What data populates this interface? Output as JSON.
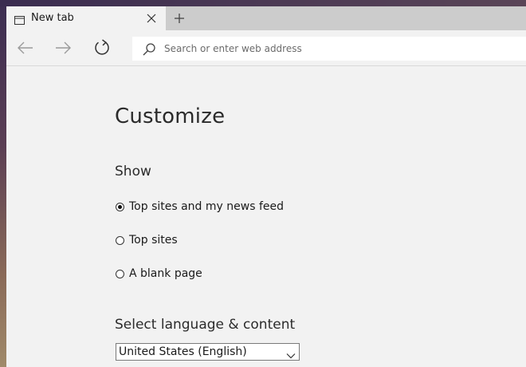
{
  "tab": {
    "title": "New tab",
    "icon": "tab-page-icon",
    "close_icon": "close-icon",
    "new_tab_icon": "plus-icon"
  },
  "navbar": {
    "back_icon": "arrow-left-icon",
    "forward_icon": "arrow-right-icon",
    "refresh_icon": "refresh-icon",
    "search_icon": "search-icon",
    "address_placeholder": "Search or enter web address",
    "address_value": ""
  },
  "page": {
    "title": "Customize",
    "show_heading": "Show",
    "options": [
      {
        "label": "Top sites and my news feed",
        "checked": true
      },
      {
        "label": "Top sites",
        "checked": false
      },
      {
        "label": "A blank page",
        "checked": false
      }
    ],
    "language_heading": "Select language & content",
    "language_selected": "United States (English)"
  },
  "colors": {
    "tabstrip_bg": "#cccccc",
    "window_bg": "#f2f2f2",
    "address_bg": "#ffffff",
    "text": "#2b2b2b"
  }
}
